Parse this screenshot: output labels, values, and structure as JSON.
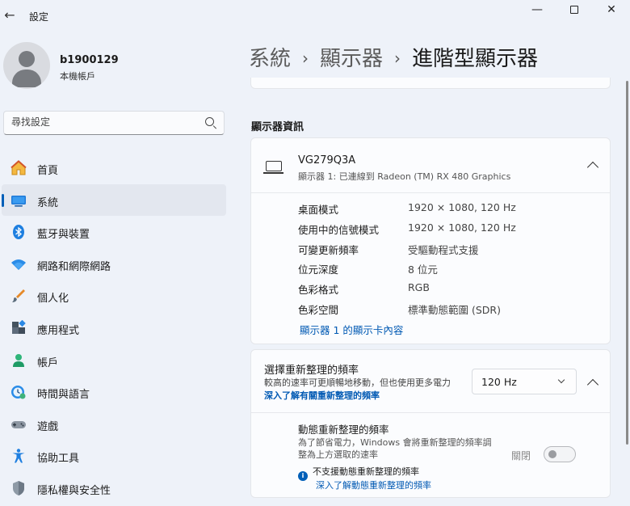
{
  "window": {
    "app_title": "設定",
    "back_icon": "back-arrow-icon",
    "minimize_icon": "minimize-icon",
    "maximize_icon": "maximize-icon",
    "close_icon": "close-icon",
    "close_glyph": "✕",
    "minimize_glyph": "—",
    "back_glyph": "←"
  },
  "profile": {
    "name": "b1900129",
    "account_type": "本機帳戶"
  },
  "search": {
    "placeholder": "尋找設定"
  },
  "sidebar": {
    "items": [
      {
        "label": "首頁",
        "icon": "home-icon",
        "active": false
      },
      {
        "label": "系統",
        "icon": "system-icon",
        "active": true
      },
      {
        "label": "藍牙與裝置",
        "icon": "bluetooth-icon",
        "active": false
      },
      {
        "label": "網路和網際網路",
        "icon": "wifi-icon",
        "active": false
      },
      {
        "label": "個人化",
        "icon": "brush-icon",
        "active": false
      },
      {
        "label": "應用程式",
        "icon": "apps-icon",
        "active": false
      },
      {
        "label": "帳戶",
        "icon": "account-icon",
        "active": false
      },
      {
        "label": "時間與語言",
        "icon": "clock-globe-icon",
        "active": false
      },
      {
        "label": "遊戲",
        "icon": "gamepad-icon",
        "active": false
      },
      {
        "label": "協助工具",
        "icon": "accessibility-icon",
        "active": false
      },
      {
        "label": "隱私權與安全性",
        "icon": "shield-icon",
        "active": false
      }
    ]
  },
  "breadcrumb": {
    "items": [
      "系統",
      "顯示器",
      "進階型顯示器"
    ],
    "separator": "›"
  },
  "display_info": {
    "section_title": "顯示器資訊",
    "monitor_name": "VG279Q3A",
    "monitor_desc": "顯示器 1: 已連線到 Radeon (TM) RX 480 Graphics",
    "rows": [
      {
        "key": "桌面模式",
        "value": "1920 × 1080, 120 Hz"
      },
      {
        "key": "使用中的信號模式",
        "value": "1920 × 1080, 120 Hz"
      },
      {
        "key": "可變更新頻率",
        "value": "受驅動程式支援"
      },
      {
        "key": "位元深度",
        "value": "8 位元"
      },
      {
        "key": "色彩格式",
        "value": "RGB"
      },
      {
        "key": "色彩空間",
        "value": "標準動態範圍 (SDR)"
      }
    ],
    "adapter_link": "顯示器 1 的顯示卡內容"
  },
  "refresh_rate": {
    "title": "選擇重新整理的頻率",
    "desc": "較高的速率可更順暢地移動，但也使用更多電力",
    "desc_link": "深入了解有關重新整理的頻率",
    "selected": "120 Hz",
    "dynamic": {
      "title": "動態重新整理的頻率",
      "desc": "為了節省電力，Windows 會將重新整理的頻率調整為上方選取的速率",
      "toggle_label": "關閉",
      "toggle_on": false,
      "unsupported_text": "不支援動態重新整理的頻率",
      "learn_link": "深入了解動態重新整理的頻率"
    }
  },
  "colors": {
    "accent": "#005fb8",
    "link": "#0059b3",
    "background": "#eef2f9",
    "card": "#fbfcfe"
  }
}
